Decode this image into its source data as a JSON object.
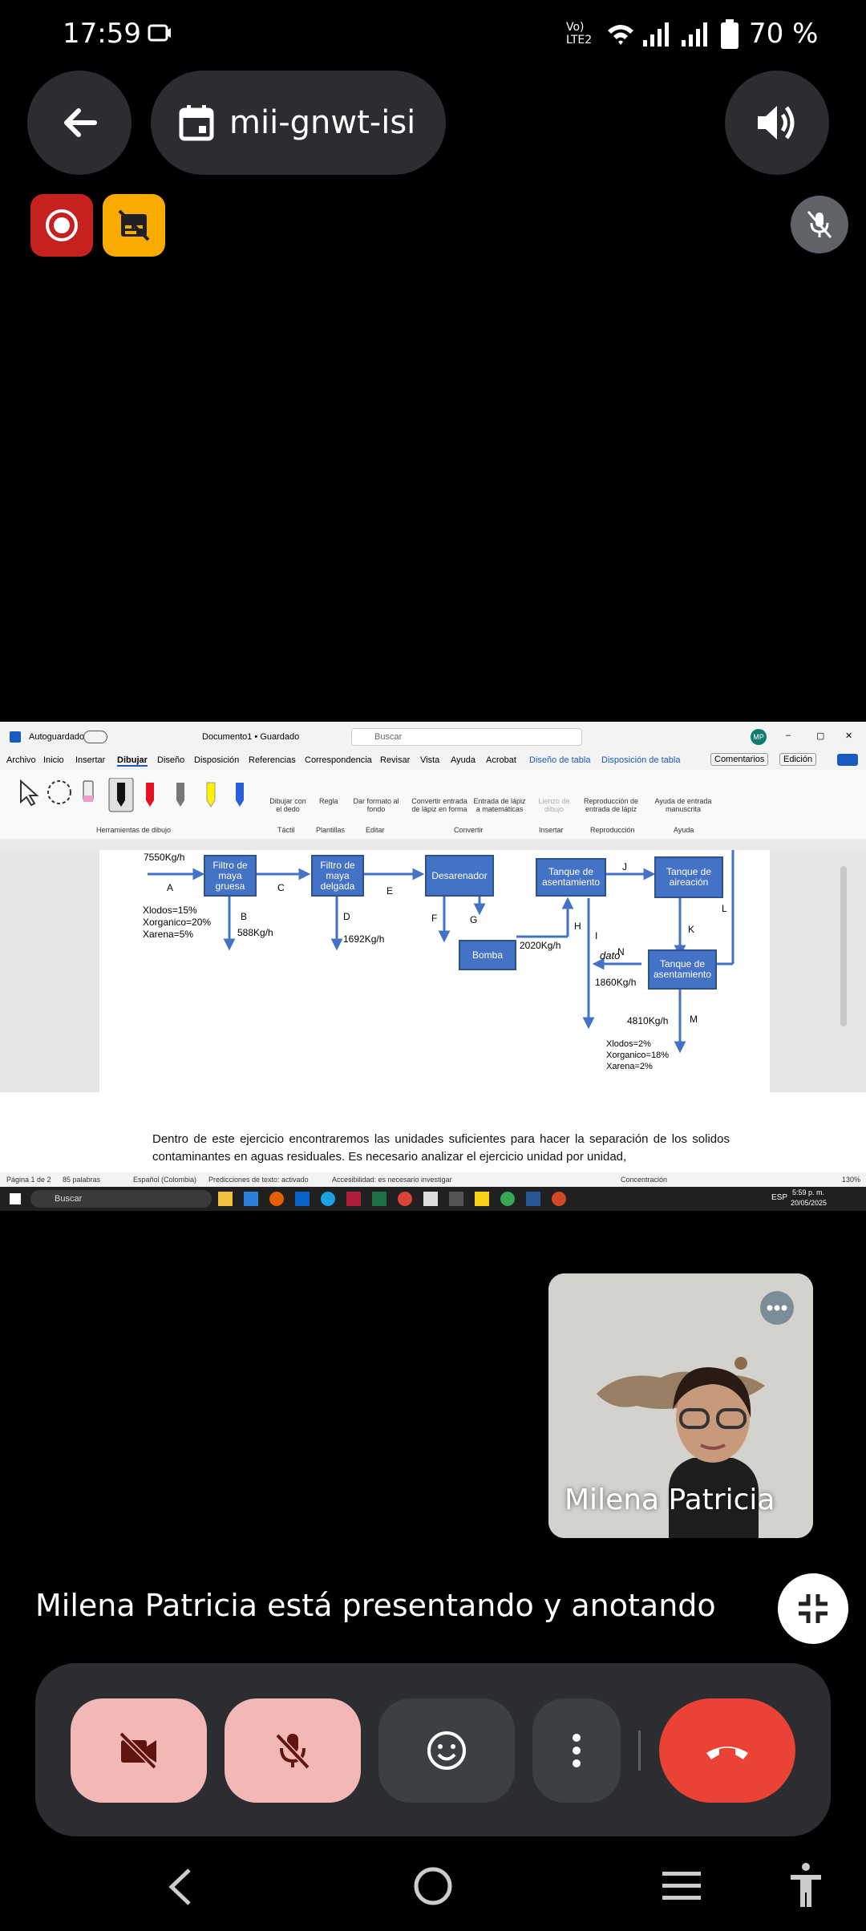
{
  "status_bar": {
    "time": "17:59",
    "network": "Vo) LTE2",
    "battery": "70 %"
  },
  "meeting": {
    "code": "mii-gnwt-isi"
  },
  "shared_screen": {
    "word": {
      "autosave": "Autoguardado",
      "doc_title": "Documento1 • Guardado",
      "search": "Buscar",
      "user_initials": "MP",
      "tabs": [
        "Archivo",
        "Inicio",
        "Insertar",
        "Dibujar",
        "Diseño",
        "Disposición",
        "Referencias",
        "Correspondencia",
        "Revisar",
        "Vista",
        "Ayuda",
        "Acrobat",
        "Diseño de tabla",
        "Disposición de tabla"
      ],
      "comments": "Comentarios",
      "editing": "Edición",
      "ribbon": {
        "draw_tools": "Herramientas de dibujo",
        "draw_finger": "Dibujar con el dedo",
        "touch": "Táctil",
        "ruler": "Regla",
        "templates": "Plantillas",
        "format_bg": "Dar formato al fondo",
        "edit": "Editar",
        "ink_shape": "Convertir entrada de lápiz en forma",
        "ink_math": "Entrada de lápiz a matemáticas",
        "convert": "Convertir",
        "canvas": "Lienzo de dibujo",
        "insert": "Insertar",
        "replay": "Reproducción de entrada de lápiz",
        "playback": "Reproducción",
        "ink_help": "Ayuda de entrada manuscrita",
        "help": "Ayuda"
      },
      "diagram": {
        "feed": "7550Kg/h",
        "feed_comp": [
          "Xlodos=15%",
          "Xorganico=20%",
          "Xarena=5%"
        ],
        "units": [
          "Filtro de maya gruesa",
          "Filtro de maya delgada",
          "Desarenador",
          "Tanque de asentamiento",
          "Tanque de aireación",
          "Bomba",
          "Tanque de asentamiento"
        ],
        "streams": [
          "A",
          "B",
          "C",
          "D",
          "E",
          "F",
          "G",
          "H",
          "I",
          "J",
          "K",
          "L",
          "M",
          "N"
        ],
        "flows": [
          "588Kg/h",
          "1692Kg/h",
          "2020Kg/h",
          "1860Kg/h",
          "4810Kg/h"
        ],
        "out_comp": [
          "Xlodos=2%",
          "Xorganico=18%",
          "Xarena=2%"
        ],
        "annot": "dato"
      },
      "paragraph": "Dentro de este ejercicio encontraremos las unidades suficientes para hacer la separación de los solidos contaminantes en aguas residuales. Es necesario analizar el ejercicio unidad por unidad,",
      "status": {
        "page": "Página 1 de 2",
        "words": "85 palabras",
        "lang": "Español (Colombia)",
        "predict": "Predicciones de texto: activado",
        "access": "Accesibilidad: es necesario investigar",
        "focus": "Concentración",
        "zoom": "130%"
      },
      "taskbar": {
        "search": "Buscar",
        "lang": "ESP",
        "time": "5:59 p. m.",
        "date": "20/05/2025"
      }
    }
  },
  "self_view": {
    "name": "Milena Patricia"
  },
  "presenting_text": "Milena Patricia está presentando y anotando",
  "colors": {
    "bg": "#000000",
    "surface": "#2b2d30",
    "pink": "#f2b8b5",
    "end_call": "#ea4335",
    "record": "#c5221f",
    "subtitle": "#f9ab00",
    "diagram_box": "#4472c4"
  }
}
